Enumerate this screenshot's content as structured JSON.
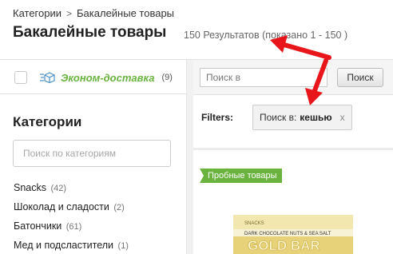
{
  "breadcrumb": {
    "items": [
      "Категории",
      "Бакалейные товары"
    ],
    "separator": ">"
  },
  "page_title": "Бакалейные товары",
  "results_count": "150 Результатов (показано 1 - 150 )",
  "sidebar": {
    "econ_delivery": {
      "label": "Эконом-доставка",
      "count": "(9)",
      "icon": "delivery-box-icon"
    },
    "categories_heading": "Категории",
    "category_search_placeholder": "Поиск по категориям",
    "categories": [
      {
        "name": "Snacks",
        "count": "(42)"
      },
      {
        "name": "Шоколад и сладости",
        "count": "(2)"
      },
      {
        "name": "Батончики",
        "count": "(61)"
      },
      {
        "name": "Мед и подсластители",
        "count": "(1)"
      }
    ]
  },
  "search_within": {
    "placeholder": "Поиск в",
    "button_label": "Поиск"
  },
  "filters": {
    "label": "Filters:",
    "chip_prefix": "Поиск в:",
    "chip_value": "кешью",
    "chip_close": "x"
  },
  "promo_badge": "Пробные товары",
  "product_image": {
    "brand": "SNACKS",
    "flavor": "DARK CHOCOLATE NUTS & SEA SALT",
    "name": "GOLD BAR"
  },
  "colors": {
    "accent_green": "#6ab33e",
    "annotation_red": "#e8151b",
    "product_gold": "#e7d27a"
  }
}
